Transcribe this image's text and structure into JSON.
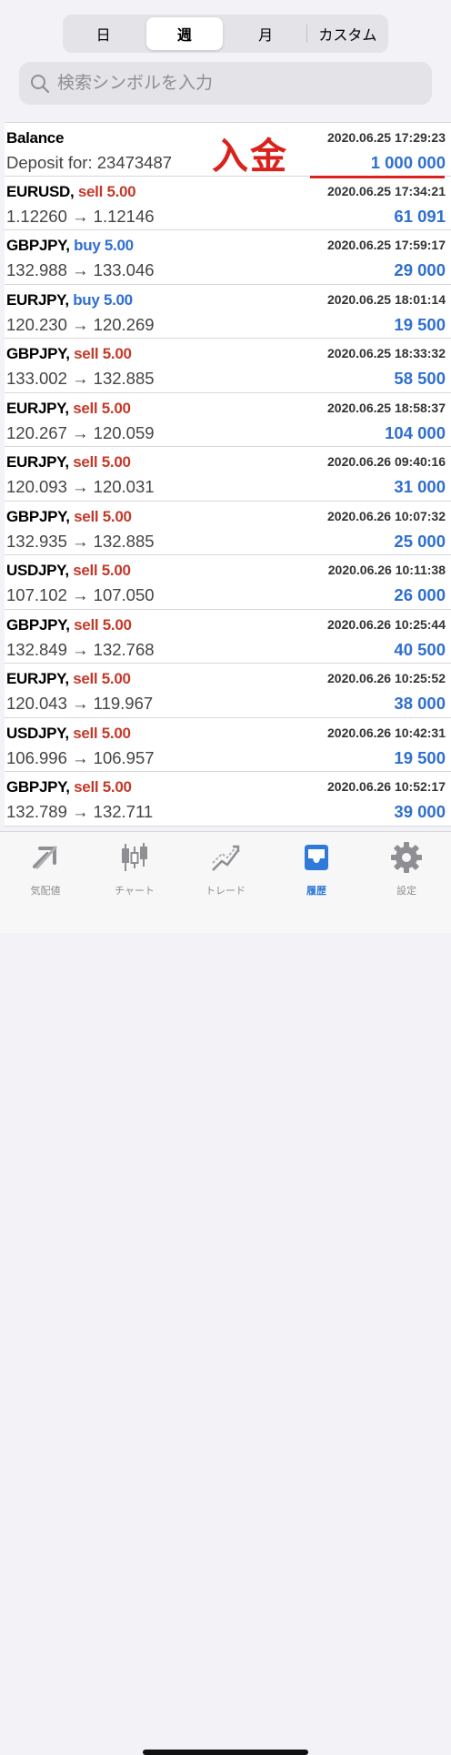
{
  "period_tabs": {
    "day": "日",
    "week": "週",
    "month": "月",
    "custom": "カスタム"
  },
  "search": {
    "placeholder": "検索シンボルを入力"
  },
  "balance": {
    "title": "Balance",
    "subtitle": "Deposit for: 23473487",
    "time": "2020.06.25 17:29:23",
    "amount": "1 000 000",
    "annotation": "入金"
  },
  "trades": [
    {
      "symbol": "EURUSD,",
      "side": "sell 5.00",
      "side_type": "sell",
      "prices": "1.12260 → 1.12146",
      "time": "2020.06.25 17:34:21",
      "profit": "61 091"
    },
    {
      "symbol": "GBPJPY,",
      "side": "buy 5.00",
      "side_type": "buy",
      "prices": "132.988 → 133.046",
      "time": "2020.06.25 17:59:17",
      "profit": "29 000"
    },
    {
      "symbol": "EURJPY,",
      "side": "buy 5.00",
      "side_type": "buy",
      "prices": "120.230 → 120.269",
      "time": "2020.06.25 18:01:14",
      "profit": "19 500"
    },
    {
      "symbol": "GBPJPY,",
      "side": "sell 5.00",
      "side_type": "sell",
      "prices": "133.002 → 132.885",
      "time": "2020.06.25 18:33:32",
      "profit": "58 500"
    },
    {
      "symbol": "EURJPY,",
      "side": "sell 5.00",
      "side_type": "sell",
      "prices": "120.267 → 120.059",
      "time": "2020.06.25 18:58:37",
      "profit": "104 000"
    },
    {
      "symbol": "EURJPY,",
      "side": "sell 5.00",
      "side_type": "sell",
      "prices": "120.093 → 120.031",
      "time": "2020.06.26 09:40:16",
      "profit": "31 000"
    },
    {
      "symbol": "GBPJPY,",
      "side": "sell 5.00",
      "side_type": "sell",
      "prices": "132.935 → 132.885",
      "time": "2020.06.26 10:07:32",
      "profit": "25 000"
    },
    {
      "symbol": "USDJPY,",
      "side": "sell 5.00",
      "side_type": "sell",
      "prices": "107.102 → 107.050",
      "time": "2020.06.26 10:11:38",
      "profit": "26 000"
    },
    {
      "symbol": "GBPJPY,",
      "side": "sell 5.00",
      "side_type": "sell",
      "prices": "132.849 → 132.768",
      "time": "2020.06.26 10:25:44",
      "profit": "40 500"
    },
    {
      "symbol": "EURJPY,",
      "side": "sell 5.00",
      "side_type": "sell",
      "prices": "120.043 → 119.967",
      "time": "2020.06.26 10:25:52",
      "profit": "38 000"
    },
    {
      "symbol": "USDJPY,",
      "side": "sell 5.00",
      "side_type": "sell",
      "prices": "106.996 → 106.957",
      "time": "2020.06.26 10:42:31",
      "profit": "19 500"
    },
    {
      "symbol": "GBPJPY,",
      "side": "sell 5.00",
      "side_type": "sell",
      "prices": "132.789 → 132.711",
      "time": "2020.06.26 10:52:17",
      "profit": "39 000"
    }
  ],
  "tabbar": {
    "quotes": "気配値",
    "chart": "チャート",
    "trade": "トレード",
    "history": "履歴",
    "settings": "設定"
  },
  "colors": {
    "sell": "#c33a2a",
    "buy": "#2f6fd0",
    "profit": "#2f6fd0",
    "annotation": "#d9221c",
    "active_tab": "#2f7ad9"
  }
}
